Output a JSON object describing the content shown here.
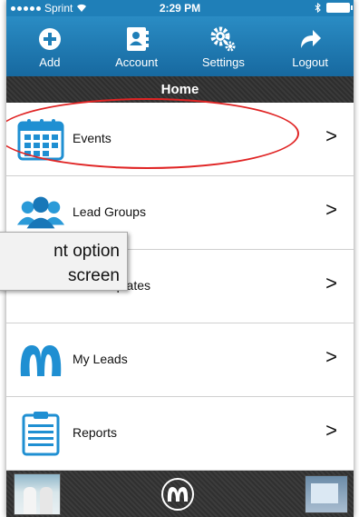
{
  "status_bar": {
    "carrier": "Sprint",
    "time": "2:29 PM"
  },
  "toolbar": {
    "add_label": "Add",
    "account_label": "Account",
    "settings_label": "Settings",
    "logout_label": "Logout"
  },
  "home": {
    "title": "Home"
  },
  "menu": {
    "items": [
      {
        "label": "Events",
        "chevron": ">"
      },
      {
        "label": "Lead Groups",
        "chevron": ">"
      },
      {
        "label": "mplates",
        "chevron": ">"
      },
      {
        "label": "My Leads",
        "chevron": ">"
      },
      {
        "label": "Reports",
        "chevron": ">"
      }
    ]
  },
  "callout": {
    "line1": "nt option",
    "line2": "screen"
  },
  "colors": {
    "toolbar_blue": "#1f7fb8",
    "annotation_red": "#e02424"
  }
}
